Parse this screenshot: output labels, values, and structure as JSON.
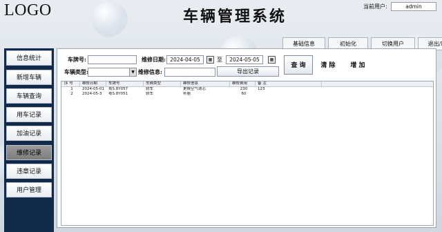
{
  "header": {
    "logo": "LOGO",
    "title": "车辆管理系统",
    "current_user_label": "当前用户:",
    "current_user": "admin"
  },
  "top_buttons": [
    "基础信息",
    "初始化",
    "切换用户",
    "退出/Exit"
  ],
  "sidebar": {
    "items": [
      "信息统计",
      "新增车辆",
      "车辆查询",
      "用车记录",
      "加油记录",
      "维修记录",
      "违章记录",
      "用户管理"
    ],
    "active_index": 5
  },
  "form": {
    "plate_label": "车牌号:",
    "plate_value": "",
    "date_label": "维修日期:",
    "date_from": "2024-04-05",
    "date_sep": "至",
    "date_to": "2024-05-05",
    "type_label": "车辆类型:",
    "type_value": "",
    "info_label": "维修信息:",
    "info_value": "",
    "export_label": "导出记录",
    "query_label": "查 询",
    "clear_label": "清 除",
    "add_label": "增 加"
  },
  "table": {
    "headers": [
      "序 号",
      "维修日期",
      "车牌号",
      "车辆类型",
      "维修信息",
      "维修费用",
      "备 注"
    ],
    "rows": [
      [
        "1",
        "2024-05-01",
        "粤S.8Y057",
        "轿车",
        "更换空气滤芯",
        "230",
        "123"
      ],
      [
        "2",
        "2024-05-3",
        "粤S.8Y051",
        "轿车",
        "补胎",
        "60",
        ""
      ]
    ]
  }
}
